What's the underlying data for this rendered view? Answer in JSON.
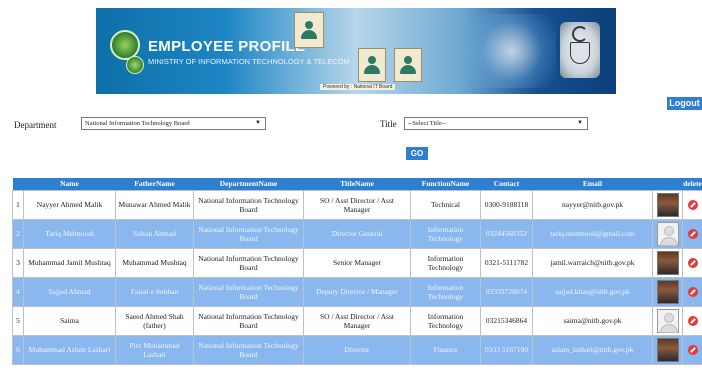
{
  "banner": {
    "title": "EMPLOYEE PROFILE",
    "subtitle": "MINISTRY OF INFORMATION TECHNOLOGY & TELECOM",
    "powered_by": "Powered by : National IT Board"
  },
  "header": {
    "logout_label": "Logout"
  },
  "filters": {
    "department_label": "Department",
    "department_value": "National Information Technology Board",
    "title_label": "Title",
    "title_value": "--Select Title--",
    "go_label": "GO"
  },
  "table": {
    "columns": [
      "Name",
      "FatherName",
      "DepartmentName",
      "TitleName",
      "FunctionName",
      "Contact",
      "Email",
      "",
      "delete"
    ],
    "rows": [
      {
        "num": "1",
        "name": "Nayyer Ahmed Malik",
        "father": "Munawar Ahmed Malik",
        "dept": "National Information Technology Board",
        "title": "SO / Asst Director / Asst Manager",
        "function": "Technical",
        "contact": "0300-9188118",
        "email": "nayyer@nitb.gov.pk",
        "photo": "real"
      },
      {
        "num": "2",
        "name": "Tariq Mehmood",
        "father": "Sultan Ahmad",
        "dept": "National Information Technology Board",
        "title": "Director General",
        "function": "Information Technology",
        "contact": "03244568352",
        "email": "tariq.mehmood@gmail.com",
        "photo": "placeholder"
      },
      {
        "num": "3",
        "name": "Muhammad Jamil Mushtaq",
        "father": "Muhammad Mushtaq",
        "dept": "National Information Technology Board",
        "title": "Senior Manager",
        "function": "Information Technology",
        "contact": "0321-5111782",
        "email": "jamil.warraich@nitb.gov.pk",
        "photo": "real"
      },
      {
        "num": "4",
        "name": "Sajjad Ahmad",
        "father": "Faisal e Subhan",
        "dept": "National Information Technology Board",
        "title": "Deputy Director / Manager",
        "function": "Information Technology",
        "contact": "03333728074",
        "email": "sajjad.khan@nitb.gov.pk",
        "photo": "real"
      },
      {
        "num": "5",
        "name": "Saima",
        "father": "Saeed Ahmed Shah (father)",
        "dept": "National Information Technology Board",
        "title": "SO / Asst Director / Asst Manager",
        "function": "Information Technology",
        "contact": "03215346864",
        "email": "saima@nitb.gov.pk",
        "photo": "placeholder"
      },
      {
        "num": "6",
        "name": "Muhammad Aslam Lashari",
        "father": "Pirz Muhammad Lashari",
        "dept": "National Information Technology Board",
        "title": "Director",
        "function": "Finance",
        "contact": "0333 5167190",
        "email": "aslam_lashari@nitb.gov.pk",
        "photo": "real"
      }
    ]
  }
}
